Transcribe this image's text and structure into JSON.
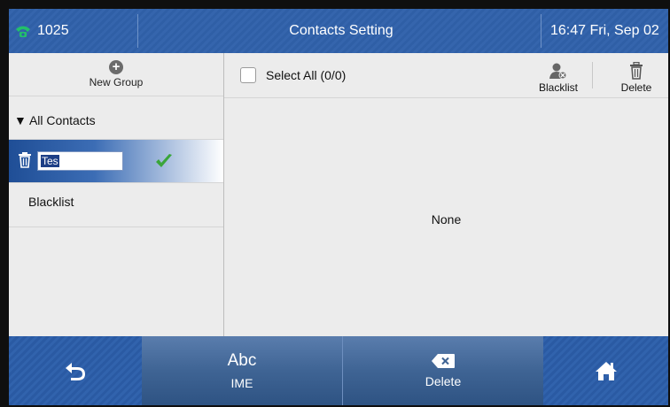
{
  "status_bar": {
    "account": "1025",
    "title": "Contacts Setting",
    "datetime": "16:47 Fri, Sep 02"
  },
  "left_panel": {
    "new_group_label": "New Group",
    "all_contacts_label": "▼ All Contacts",
    "editing_group": {
      "value": "Tes"
    },
    "blacklist_label": "Blacklist"
  },
  "right_panel": {
    "select_all_label": "Select All (0/0)",
    "blacklist_button_label": "Blacklist",
    "delete_button_label": "Delete",
    "empty_text": "None"
  },
  "softkeys": {
    "ime_top": "Abc",
    "ime_label": "IME",
    "delete_label": "Delete"
  },
  "colors": {
    "accent": "#2f5fa6",
    "selection": "#1f4e96",
    "confirm": "#3aa53a"
  },
  "icons": [
    "phone-icon",
    "plus-circle-icon",
    "trash-icon",
    "check-icon",
    "blacklist-user-icon",
    "backspace-icon",
    "back-arrow-icon",
    "home-icon"
  ]
}
